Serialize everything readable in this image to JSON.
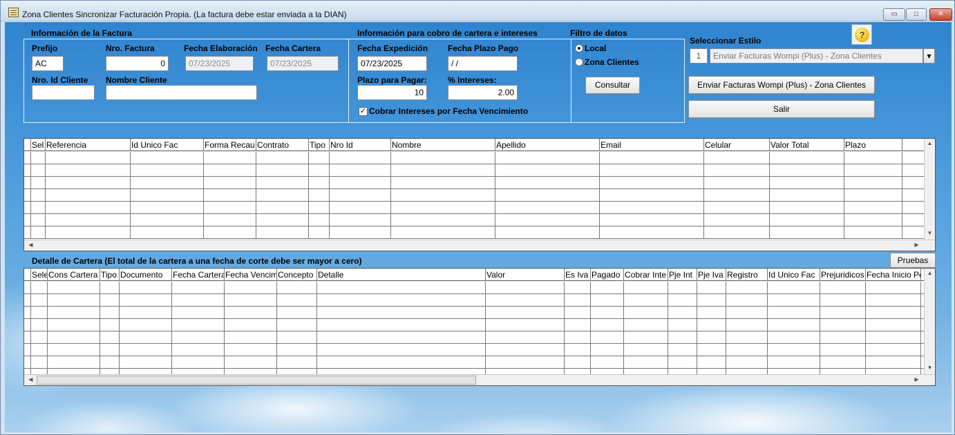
{
  "window": {
    "title": "Zona Clientes Sincronizar Facturación Propia. (La factura debe estar enviada a la DIAN)",
    "min_glyph": "▭",
    "max_glyph": "□",
    "close_glyph": "✕"
  },
  "factura": {
    "section_title": "Información de la Factura",
    "prefijo_label": "Prefijo",
    "prefijo_value": "AC",
    "nro_factura_label": "Nro. Factura",
    "nro_factura_value": "0",
    "fecha_elaboracion_label": "Fecha Elaboración",
    "fecha_elaboracion_value": "07/23/2025",
    "fecha_cartera_label": "Fecha Cartera",
    "fecha_cartera_value": "07/23/2025",
    "nro_id_cliente_label": "Nro. Id Cliente",
    "nro_id_cliente_value": "",
    "nombre_cliente_label": "Nombre Cliente",
    "nombre_cliente_value": ""
  },
  "cobro": {
    "section_title": "Información para cobro de cartera e intereses",
    "fecha_expedicion_label": "Fecha Expedición",
    "fecha_expedicion_value": "07/23/2025",
    "fecha_plazo_label": "Fecha Plazo Pago",
    "fecha_plazo_value": " / /",
    "plazo_label": "Plazo para Pagar:",
    "plazo_value": "10",
    "intereses_label": "% Intereses:",
    "intereses_value": "2.00",
    "cobrar_intereses_label": "Cobrar Intereses por Fecha Vencimiento",
    "cobrar_intereses_checked": true,
    "check_glyph": "✓"
  },
  "filtro": {
    "section_title": "Filtro de datos",
    "local_label": "Local",
    "zona_label": "Zona Clientes",
    "selected": "local",
    "consultar_label": "Consultar"
  },
  "estilo": {
    "label": "Seleccionar Estilo",
    "number": "1",
    "selected": "Enviar Facturas Wompi (Plus) - Zona Clientes",
    "dropdown_glyph": "▾",
    "enviar_button": "Enviar Facturas Wompi (Plus) - Zona Clientes",
    "salir_button": "Salir",
    "help_glyph": "?"
  },
  "grid1": {
    "columns": [
      "Sel",
      "Referencia",
      "Id Unico Fac",
      "Forma Recau",
      "Contrato",
      "Tipo",
      "Nro Id",
      "Nombre",
      "Apellido",
      "Email",
      "Celular",
      "Valor Total",
      "Plazo"
    ]
  },
  "detalle": {
    "title": "Detalle de Cartera (El total de la cartera a una fecha de corte debe ser mayor a cero)",
    "pruebas_button": "Pruebas",
    "columns": [
      "Sele",
      "Cons Cartera",
      "Tipo",
      "Documento",
      "Fecha Cartera",
      "Fecha Vencim",
      "Concepto",
      "Detalle",
      "Valor",
      "Es Iva",
      "Pagado",
      "Cobrar Inte",
      "Pje Int",
      "Pje Iva",
      "Registro",
      "Id Unico Fac",
      "Prejuridicos",
      "Fecha Inicio Pe"
    ]
  },
  "scroll": {
    "up": "▲",
    "down": "▼",
    "left": "◀",
    "right": "▶"
  },
  "colors": {
    "sky_top": "#2f84cf",
    "frame_border": "#e9f2fb"
  }
}
